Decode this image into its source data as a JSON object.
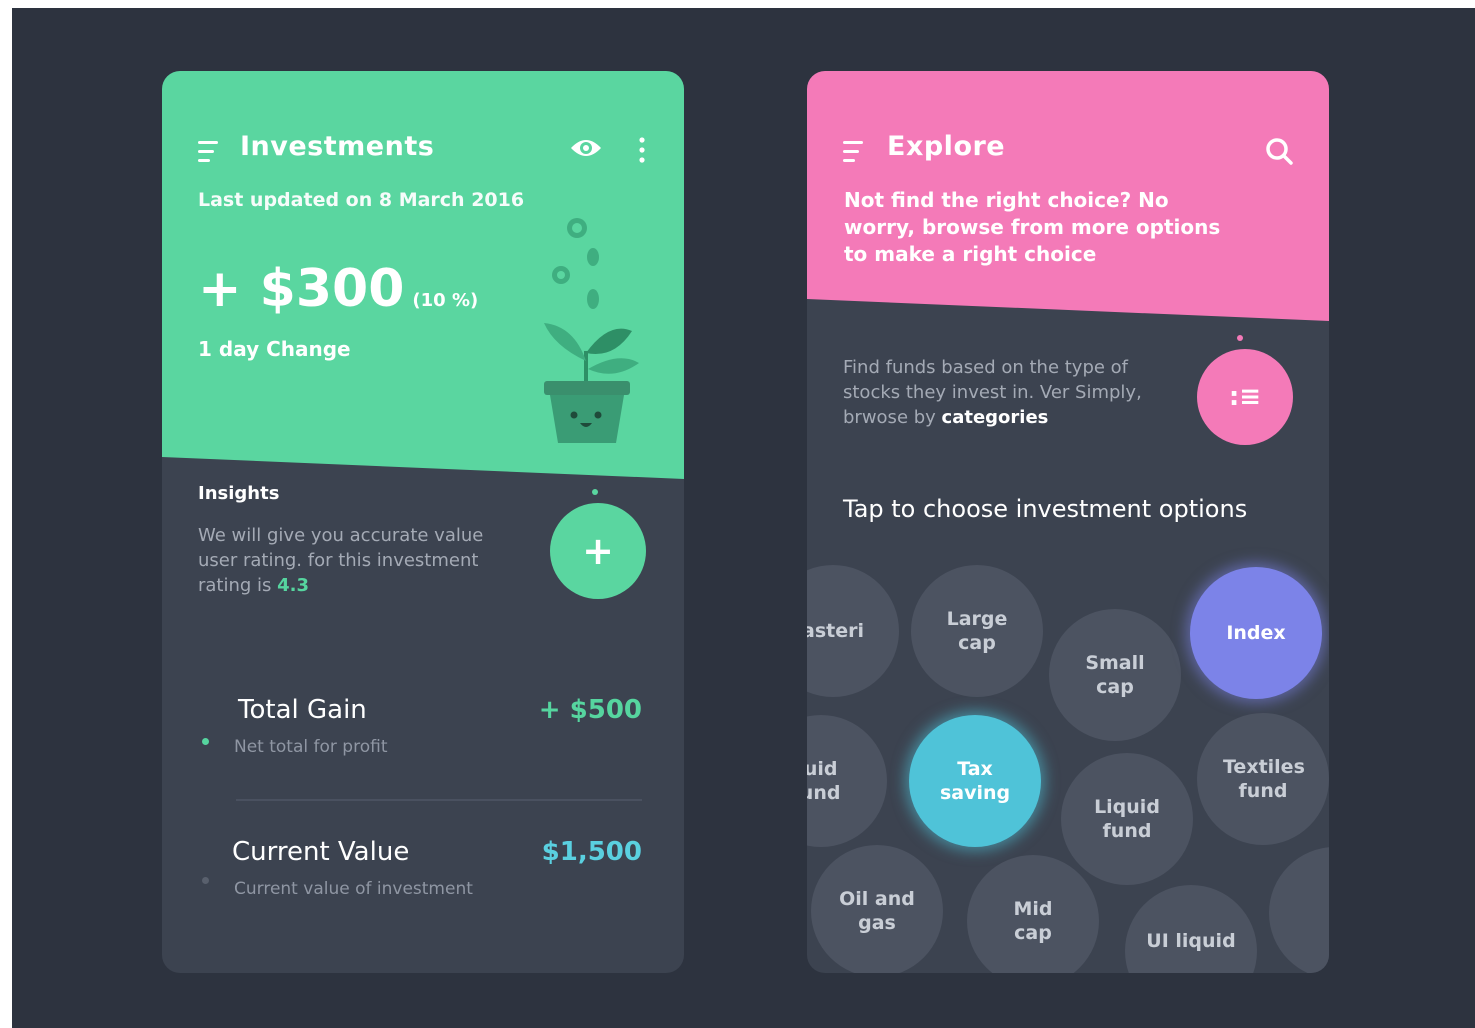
{
  "colors": {
    "background": "#2d333f",
    "card": "#3c4350",
    "green": "#5ad6a0",
    "pink": "#f47ab8",
    "purple": "#7c83e8",
    "cyan": "#4fc3d8",
    "value_green": "#56d59f",
    "value_cyan": "#5ad0e0"
  },
  "investments": {
    "menu_icon": "menu-icon",
    "title": "Investments",
    "visibility_icon": "eye-icon",
    "more_icon": "more-vertical-icon",
    "last_updated": "Last updated on 8 March 2016",
    "amount": "+ $300",
    "percent": "(10 %)",
    "change_label": "1 day Change",
    "illustration": "plant-pot-with-coins",
    "insights": {
      "title": "Insights",
      "text": "We will give you accurate value user rating. for this investment rating is ",
      "rating": "4.3"
    },
    "fab_label": "+",
    "rows": [
      {
        "title": "Total Gain",
        "subtitle": "Net total for profit",
        "value": "+ $500"
      },
      {
        "title": "Current Value",
        "subtitle": "Current value of investment",
        "value": "$1,500"
      }
    ]
  },
  "explore": {
    "menu_icon": "menu-icon",
    "title": "Explore",
    "search_icon": "search-icon",
    "intro": "Not find the right choice? No worry, browse from more options to make a right choice",
    "funds_text": "Find funds based on the type of stocks they invest in. Ver Simply, brwose by ",
    "funds_link": "categories",
    "fab_icon": "list-icon",
    "fab_label": ":≡",
    "choose_title": "Tap to choose investment options",
    "bubbles": [
      {
        "label": "asteri",
        "state": "normal"
      },
      {
        "label": "Large cap",
        "state": "normal"
      },
      {
        "label": "Small cap",
        "state": "normal"
      },
      {
        "label": "Index",
        "state": "selected"
      },
      {
        "label": "ruid fund",
        "state": "normal"
      },
      {
        "label": "Tax saving",
        "state": "selected"
      },
      {
        "label": "Liquid fund",
        "state": "normal"
      },
      {
        "label": "Textiles fund",
        "state": "normal"
      },
      {
        "label": "Oil and gas",
        "state": "normal"
      },
      {
        "label": "Mid cap",
        "state": "normal"
      },
      {
        "label": "UI liquid",
        "state": "normal"
      },
      {
        "label": "",
        "state": "normal"
      }
    ]
  }
}
